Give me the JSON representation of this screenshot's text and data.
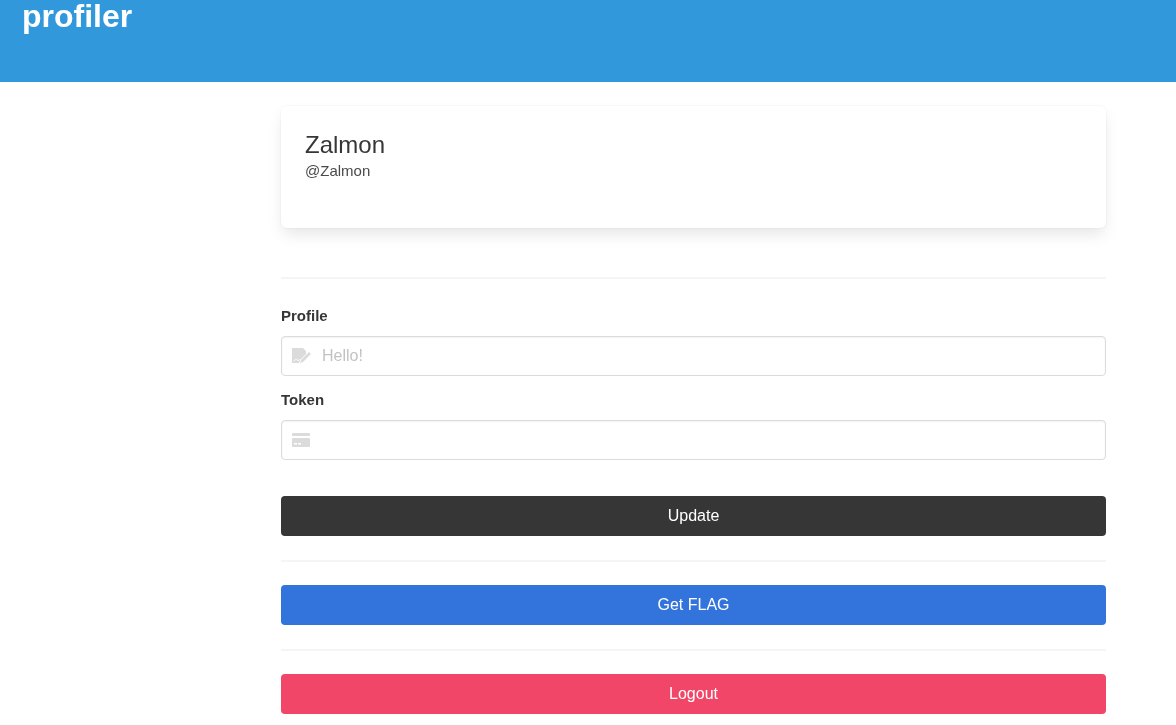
{
  "header": {
    "title": "profiler"
  },
  "profile_card": {
    "name": "Zalmon",
    "handle": "@Zalmon"
  },
  "fields": [
    {
      "label": "Profile",
      "kind": "note",
      "placeholder": "Hello!"
    },
    {
      "label": "Token",
      "kind": "card"
    }
  ],
  "buttons": [
    {
      "label": "Update",
      "kind": "dark"
    },
    {
      "label": "Get FLAG",
      "kind": "link"
    },
    {
      "label": "Logout",
      "kind": "danger"
    }
  ]
}
